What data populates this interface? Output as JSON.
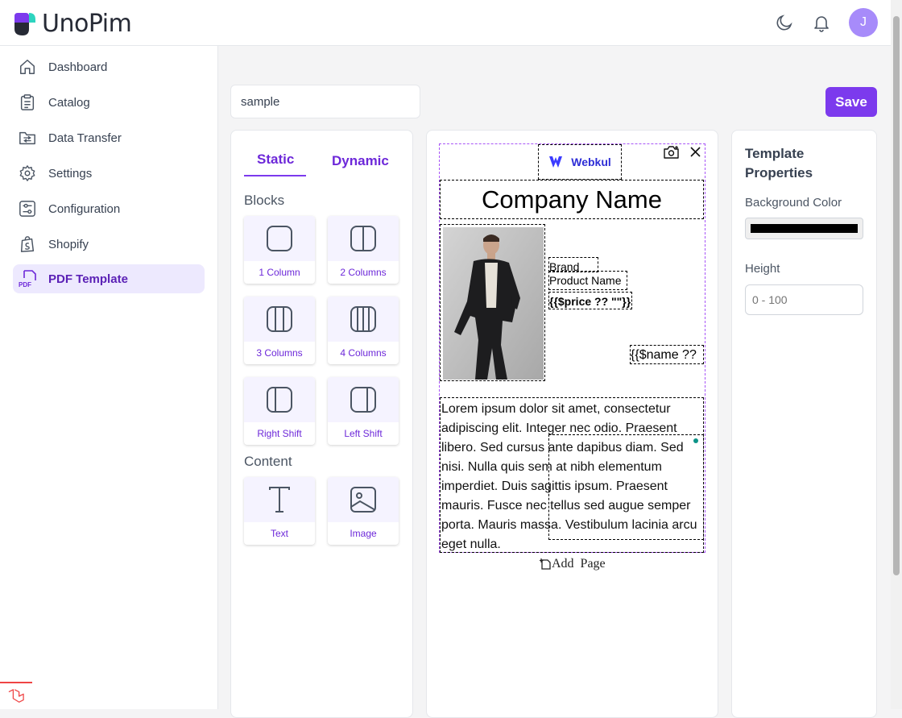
{
  "app": {
    "logo_text": "UnoPim",
    "user_initial": "J"
  },
  "sidebar": {
    "items": [
      {
        "label": "Dashboard",
        "icon": "home-icon"
      },
      {
        "label": "Catalog",
        "icon": "catalog-icon"
      },
      {
        "label": "Data Transfer",
        "icon": "data-transfer-icon"
      },
      {
        "label": "Settings",
        "icon": "gear-icon"
      },
      {
        "label": "Configuration",
        "icon": "sliders-icon"
      },
      {
        "label": "Shopify",
        "icon": "shopify-icon"
      },
      {
        "label": "PDF Template",
        "icon": "pdf-icon",
        "active": true
      }
    ]
  },
  "form": {
    "template_name": "sample",
    "save_label": "Save"
  },
  "builder": {
    "tabs": [
      "Static",
      "Dynamic"
    ],
    "blocks_heading": "Blocks",
    "blocks": [
      "1 Column",
      "2 Columns",
      "3 Columns",
      "4 Columns",
      "Right Shift",
      "Left Shift"
    ],
    "content_heading": "Content",
    "content": [
      "Text",
      "Image"
    ]
  },
  "canvas": {
    "logo_text": "Webkul",
    "company_name": "Company Name",
    "brand": "Brand",
    "product_name": "Product Name",
    "price": "{{$price ?? \"\"}}",
    "name_var": "{{$name ??",
    "lorem": "Lorem ipsum dolor sit amet, consectetur adipiscing elit. Integer nec odio. Praesent libero. Sed cursus ante dapibus diam. Sed nisi. Nulla quis sem at nibh elementum imperdiet. Duis sagittis ipsum. Praesent mauris. Fusce nec tellus sed augue semper porta. Mauris massa. Vestibulum lacinia arcu eget nulla.",
    "add_page": "Add  Page"
  },
  "properties": {
    "title": "Template Properties",
    "bg_label": "Background Color",
    "bg_value": "#000000",
    "height_label": "Height",
    "height_placeholder": "0 - 100"
  },
  "colors": {
    "accent": "#7c3aed",
    "accent_light": "#ede9fe"
  }
}
